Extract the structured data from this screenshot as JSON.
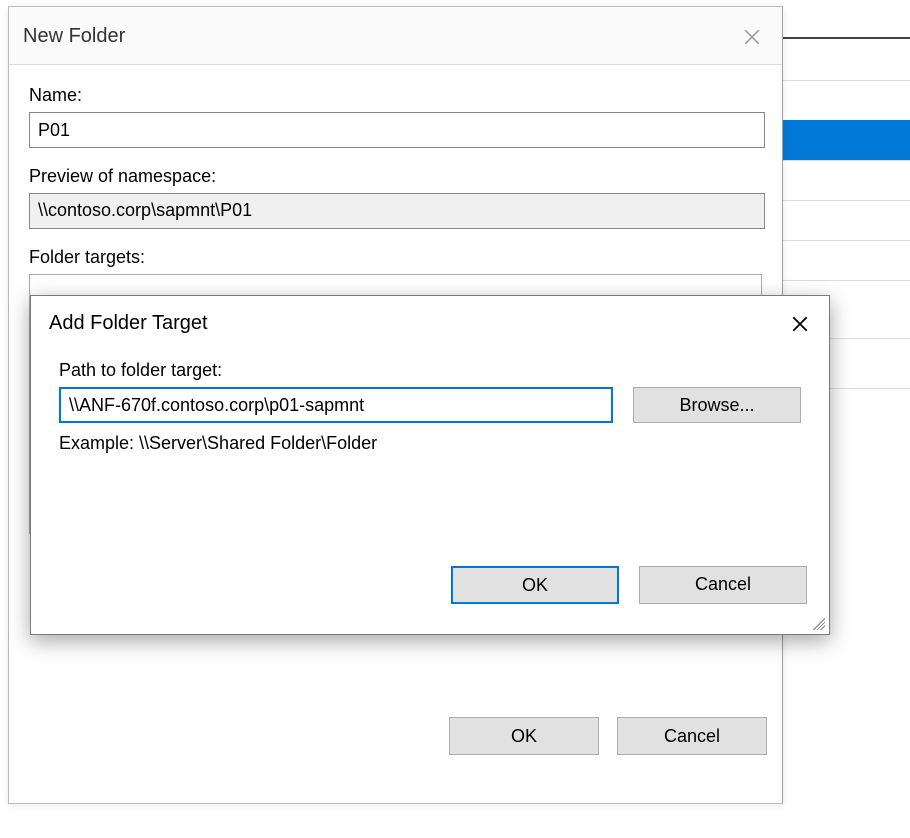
{
  "dialog1": {
    "title": "New Folder",
    "name_label": "Name:",
    "name_value": "P01",
    "preview_label": "Preview of namespace:",
    "preview_value": "\\\\contoso.corp\\sapmnt\\P01",
    "targets_label": "Folder targets:",
    "ok_label": "OK",
    "cancel_label": "Cancel"
  },
  "dialog2": {
    "title": "Add Folder Target",
    "path_label": "Path to folder target:",
    "path_value": "\\\\ANF-670f.contoso.corp\\p01-sapmnt",
    "browse_label": "Browse...",
    "example_text": "Example: \\\\Server\\Shared Folder\\Folder",
    "ok_label": "OK",
    "cancel_label": "Cancel"
  }
}
